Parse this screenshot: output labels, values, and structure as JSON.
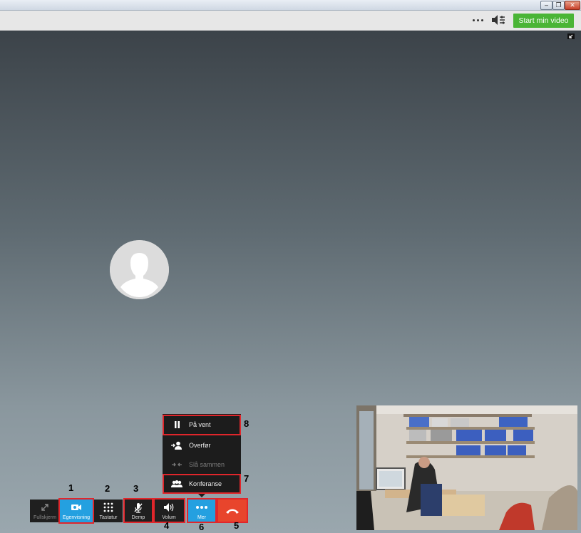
{
  "window": {
    "min": "–",
    "max": "❐",
    "close": "✕"
  },
  "toolbar": {
    "start_video": "Start min video"
  },
  "controls": {
    "fullscreen": "Fullskjerm",
    "selfview": "Egenvisning",
    "keypad": "Tastatur",
    "mute": "Demp",
    "volume": "Volum",
    "more": "Mer"
  },
  "menu": {
    "hold": "På vent",
    "transfer": "Overfør",
    "merge": "Slå sammen",
    "conference": "Konferanse"
  },
  "callouts": [
    "1",
    "2",
    "3",
    "4",
    "5",
    "6",
    "7",
    "8"
  ],
  "colors": {
    "accent_green": "#4ab536",
    "accent_blue": "#24a0e0",
    "end_call_red": "#e8452c",
    "highlight_red": "#e0262b"
  }
}
